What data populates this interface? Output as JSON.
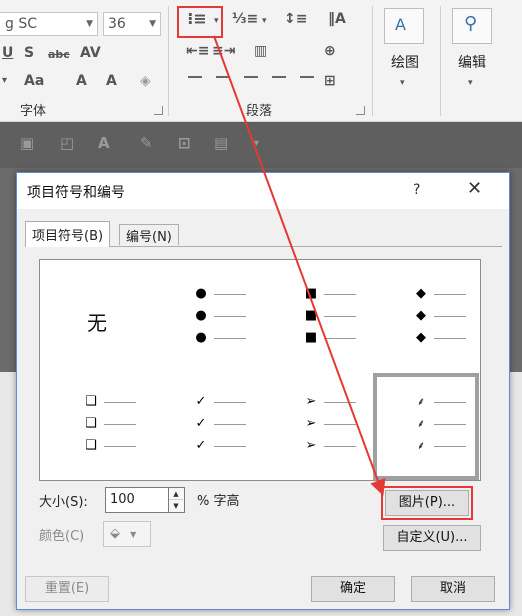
{
  "ribbon": {
    "font_name": "g SC",
    "font_size": "36",
    "font_group_label": "字体",
    "paragraph_group_label": "段落",
    "picture_label": "绘图",
    "edit_label": "编辑"
  },
  "dialog": {
    "title": "项目符号和编号",
    "help": "?",
    "close": "✕",
    "tabs": [
      {
        "label": "项目符号(B)"
      },
      {
        "label": "编号(N)"
      }
    ],
    "gallery": {
      "none_label": "无",
      "bullets": [
        "●",
        "■",
        "◆",
        "❑",
        "✓",
        "➢",
        "⸙"
      ]
    },
    "size_label": "大小(S):",
    "size_value": "100",
    "size_unit": "% 字高",
    "color_label": "颜色(C)",
    "picture_button": "图片(P)...",
    "custom_button": "自定义(U)...",
    "reset_button": "重置(E)",
    "ok_button": "确定",
    "cancel_button": "取消"
  },
  "colors": {
    "highlight": "#e53935",
    "dialog_border": "#5b8ed6"
  }
}
